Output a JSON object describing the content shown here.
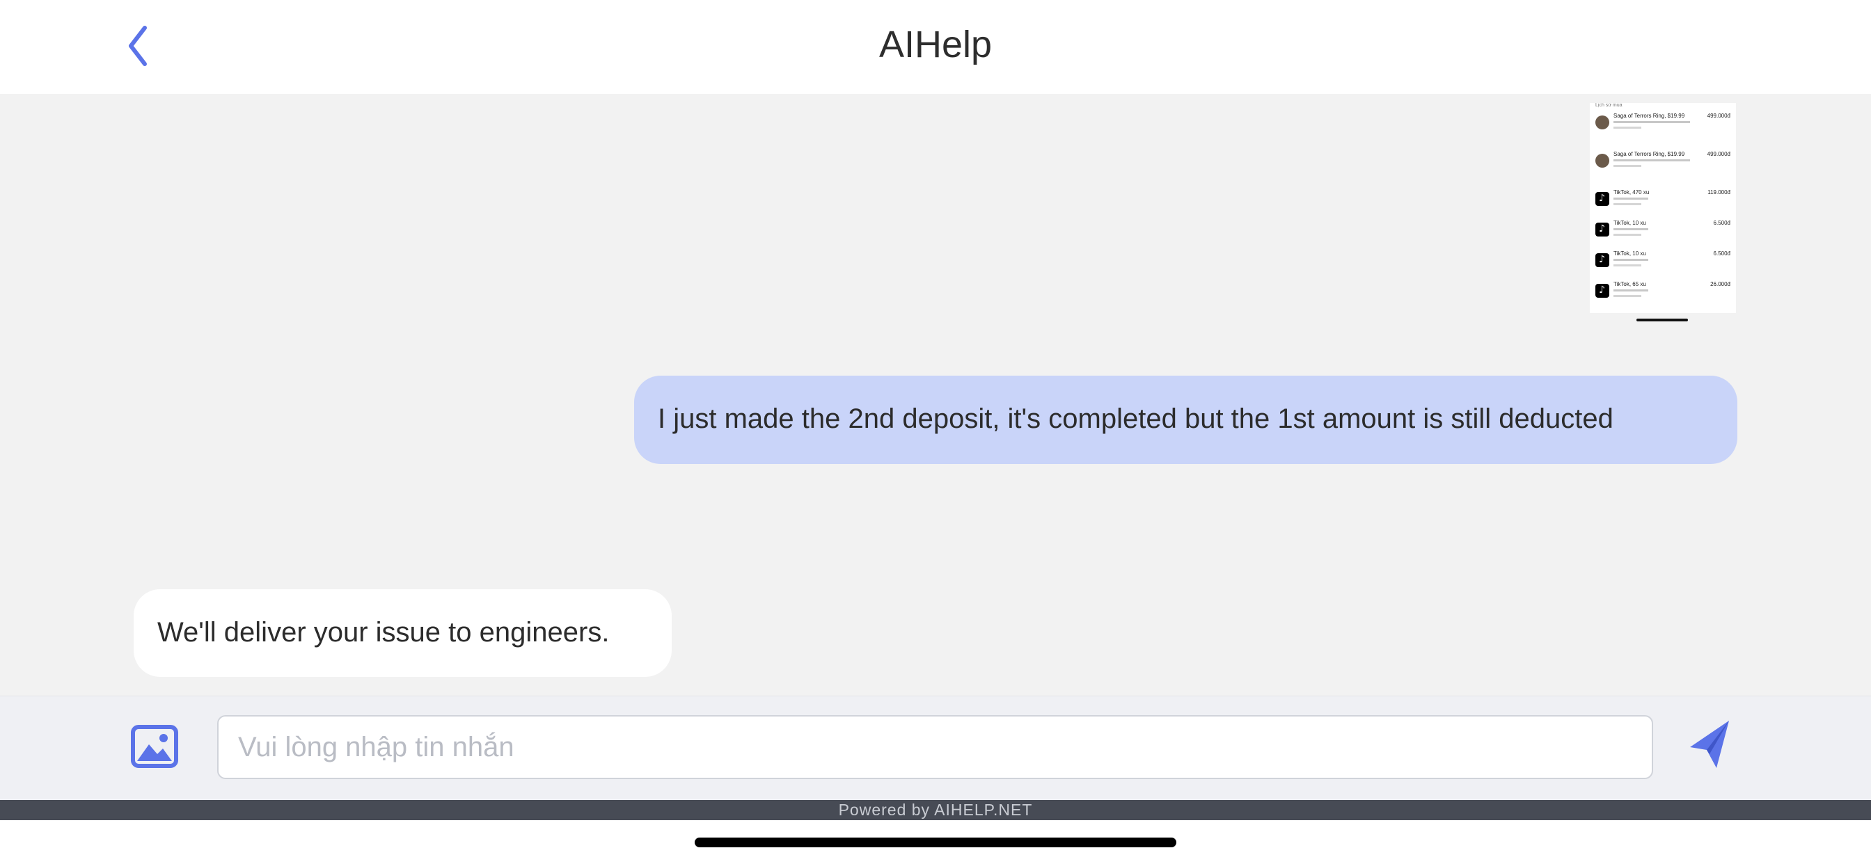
{
  "header": {
    "title": "AIHelp",
    "back_icon": "chevron-left-icon"
  },
  "colors": {
    "accent": "#5b73e8",
    "user_bubble": "#c9d4f9",
    "bot_bubble": "#ffffff",
    "chat_background": "#f2f2f2",
    "footer_bar": "#474b55"
  },
  "messages": [
    {
      "sender": "user",
      "type": "image",
      "content": {
        "heading": "Lịch sử mua",
        "rows": [
          {
            "icon": "game-avatar-icon",
            "title": "Saga of Terrors Ring, $19.99",
            "price": "499.000đ"
          },
          {
            "icon": "game-avatar-icon",
            "title": "Saga of Terrors Ring, $19.99",
            "price": "499.000đ"
          },
          {
            "icon": "tiktok-icon",
            "title": "TikTok, 470 xu",
            "price": "119.000đ"
          },
          {
            "icon": "tiktok-icon",
            "title": "TikTok, 10 xu",
            "price": "6.500đ"
          },
          {
            "icon": "tiktok-icon",
            "title": "TikTok, 10 xu",
            "price": "6.500đ"
          },
          {
            "icon": "tiktok-icon",
            "title": "TikTok, 65 xu",
            "price": "26.000đ"
          }
        ]
      }
    },
    {
      "sender": "user",
      "type": "text",
      "text": "I just made the 2nd deposit, it's completed but the 1st amount is still deducted"
    },
    {
      "sender": "bot",
      "type": "text",
      "text": "We'll deliver your issue to engineers."
    }
  ],
  "composer": {
    "placeholder": "Vui lòng nhập tin nhắn",
    "value": "",
    "image_icon": "image-icon",
    "send_icon": "send-icon"
  },
  "footer": {
    "powered_by": "Powered by AIHELP.NET"
  }
}
